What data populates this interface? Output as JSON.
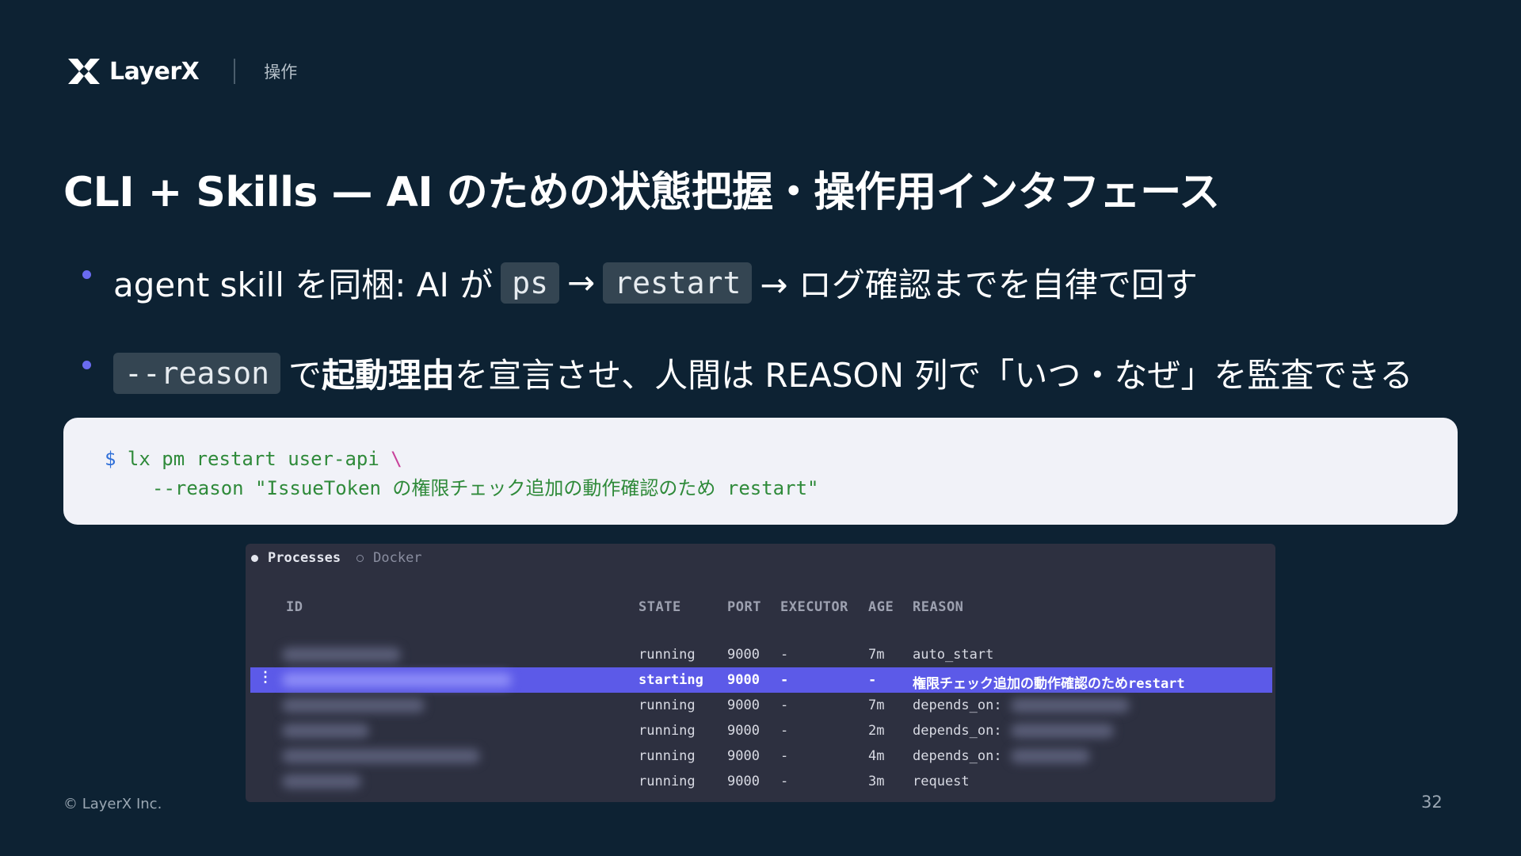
{
  "header": {
    "logo_text": "LayerX",
    "section": "操作"
  },
  "title": "CLI + Skills — AI のための状態把握・操作用インタフェース",
  "bullets": [
    {
      "text_a": "agent skill を同梱: AI が",
      "code_a": "ps",
      "arrow_a": "→",
      "code_b": "restart",
      "text_b": "→ ログ確認までを自律で回す"
    },
    {
      "code": "--reason",
      "text_a": "で",
      "strong": "起動理由",
      "text_b": "を宣言させ、人間は REASON 列で「いつ・なぜ」を監査できる"
    }
  ],
  "code_block": {
    "prompt": "$",
    "command": "lx pm restart user-api",
    "continuation": "\\",
    "arg_line": "--reason \"IssueToken の権限チェック追加の動作確認のため restart\""
  },
  "terminal": {
    "tabs": [
      {
        "label": "Processes",
        "active": true
      },
      {
        "label": "Docker",
        "active": false
      }
    ],
    "columns": [
      "ID",
      "STATE",
      "PORT",
      "EXECUTOR",
      "AGE",
      "REASON"
    ],
    "rows": [
      {
        "state": "running",
        "port": "9000",
        "executor": "-",
        "age": "7m",
        "reason": "auto_start",
        "selected": false
      },
      {
        "state": "starting",
        "port": "9000",
        "executor": "-",
        "age": "-",
        "reason": "権限チェック追加の動作確認のためrestart",
        "selected": true
      },
      {
        "state": "running",
        "port": "9000",
        "executor": "-",
        "age": "7m",
        "reason": "depends_on:",
        "selected": false
      },
      {
        "state": "running",
        "port": "9000",
        "executor": "-",
        "age": "2m",
        "reason": "depends_on:",
        "selected": false
      },
      {
        "state": "running",
        "port": "9000",
        "executor": "-",
        "age": "4m",
        "reason": "depends_on:",
        "selected": false
      },
      {
        "state": "running",
        "port": "9000",
        "executor": "-",
        "age": "3m",
        "reason": "request",
        "selected": false
      }
    ],
    "selected_marker": "⋮"
  },
  "footer": {
    "copyright": "© LayerX Inc.",
    "page_number": "32"
  },
  "colors": {
    "background": "#0d2233",
    "accent": "#5c5ae8",
    "bullet_dot": "#6a6bf0",
    "code_bg": "#f1f2f8",
    "terminal_bg": "#2d3040"
  },
  "icons": {
    "logo": "layerx-logo-icon"
  }
}
